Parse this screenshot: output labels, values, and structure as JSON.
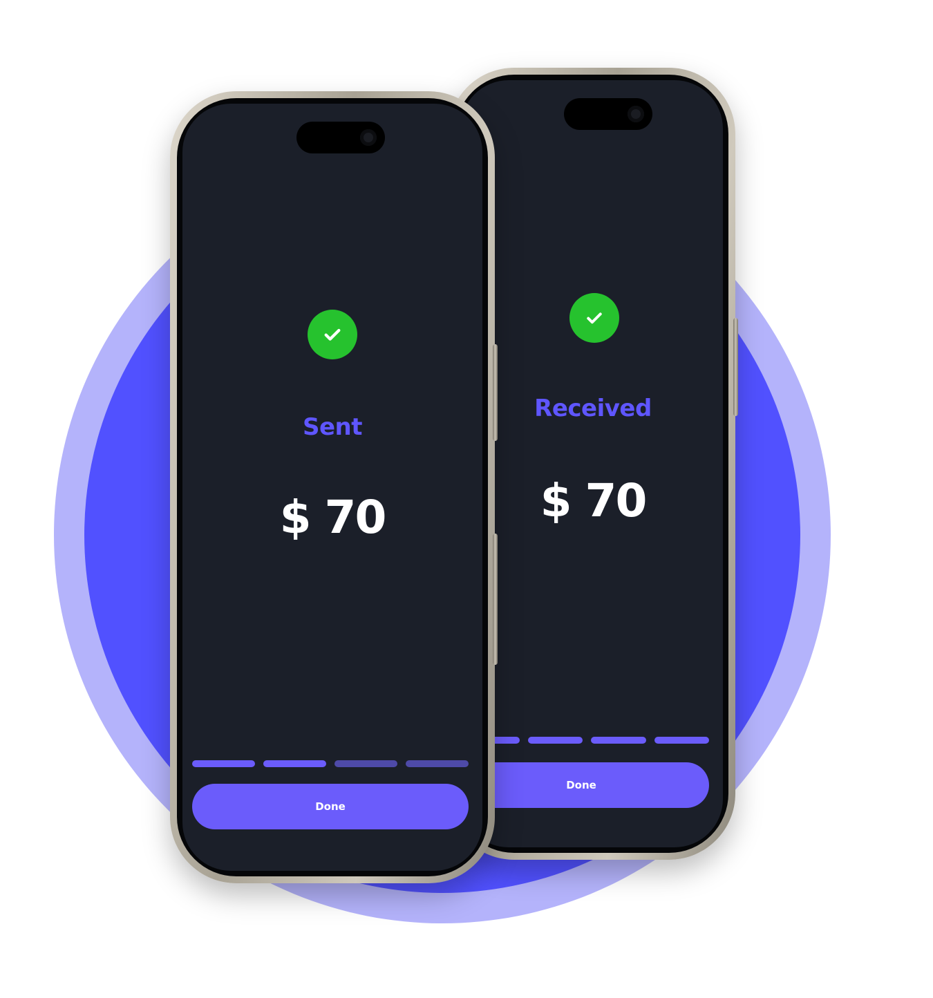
{
  "phones": {
    "sent": {
      "status_title": "Sent",
      "amount": "$ 70",
      "done_label": "Done",
      "progress_step": 2,
      "progress_total": 4
    },
    "received": {
      "status_title": "Received",
      "amount": "$ 70",
      "done_label": "Done",
      "progress_step": 4,
      "progress_total": 4
    }
  },
  "icons": {
    "status": "check-circle-icon",
    "camera": "camera-icon"
  },
  "colors": {
    "accent": "#5f56ff",
    "button": "#6b5cfb",
    "success": "#26c22e",
    "screen": "#1b1f29",
    "circle_outer": "#b4b3fb",
    "circle_inner": "#5151ff",
    "progress_active": "#6b5cfb",
    "progress_inactive": "#4e4aa8"
  }
}
